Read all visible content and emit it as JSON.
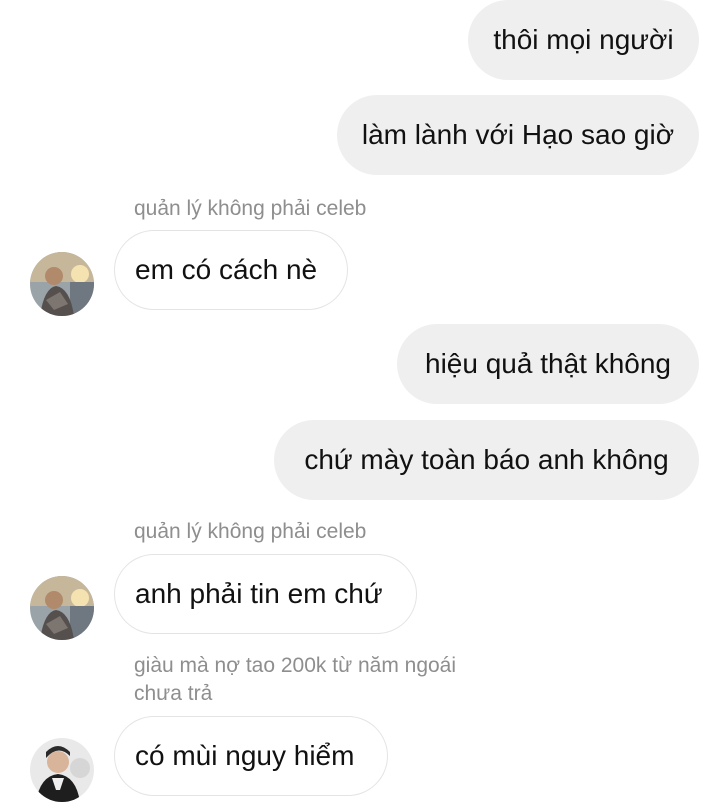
{
  "messages": {
    "m1": {
      "text": "thôi mọi người"
    },
    "m2": {
      "text": "làm lành với Hạo sao giờ"
    },
    "m3": {
      "sender": "quản lý không phải celeb",
      "text": "em có cách nè"
    },
    "m4": {
      "text": "hiệu quả thật không"
    },
    "m5": {
      "text": "chứ mày toàn báo anh không"
    },
    "m6": {
      "sender": "quản lý không phải celeb",
      "text": "anh phải tin em chứ"
    },
    "m7": {
      "sender_line1": "giàu mà nợ tao 200k từ năm ngoái",
      "sender_line2": "chưa trả",
      "text": "có mùi nguy hiểm"
    }
  },
  "colors": {
    "outgoing_bubble": "#efefef",
    "incoming_border": "#e4e4e4",
    "sender_name": "#8e8e8e"
  },
  "icons": [
    "avatar-manager",
    "avatar-friend"
  ]
}
